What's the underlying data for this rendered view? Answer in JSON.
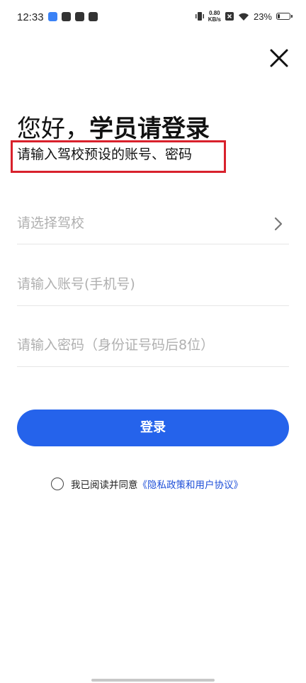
{
  "status_bar": {
    "time": "12:33",
    "net_speed_value": "0.80",
    "net_speed_unit": "KB/s",
    "battery_percent": "23%",
    "battery_level": 0.23
  },
  "login": {
    "greeting_prefix": "您好，",
    "greeting_strong": "学员请登录",
    "subtitle": "请输入驾校预设的账号、密码",
    "school_placeholder": "请选择驾校",
    "account_placeholder": "请输入账号(手机号)",
    "password_placeholder": "请输入密码（身份证号码后8位）",
    "login_button": "登录",
    "agreement_text": "我已阅读并同意",
    "agreement_link": "《隐私政策和用户协议》"
  },
  "colors": {
    "primary": "#2563eb",
    "link": "#1d4ed8",
    "highlight_border": "#d8212c",
    "placeholder": "#b0b0b0"
  }
}
